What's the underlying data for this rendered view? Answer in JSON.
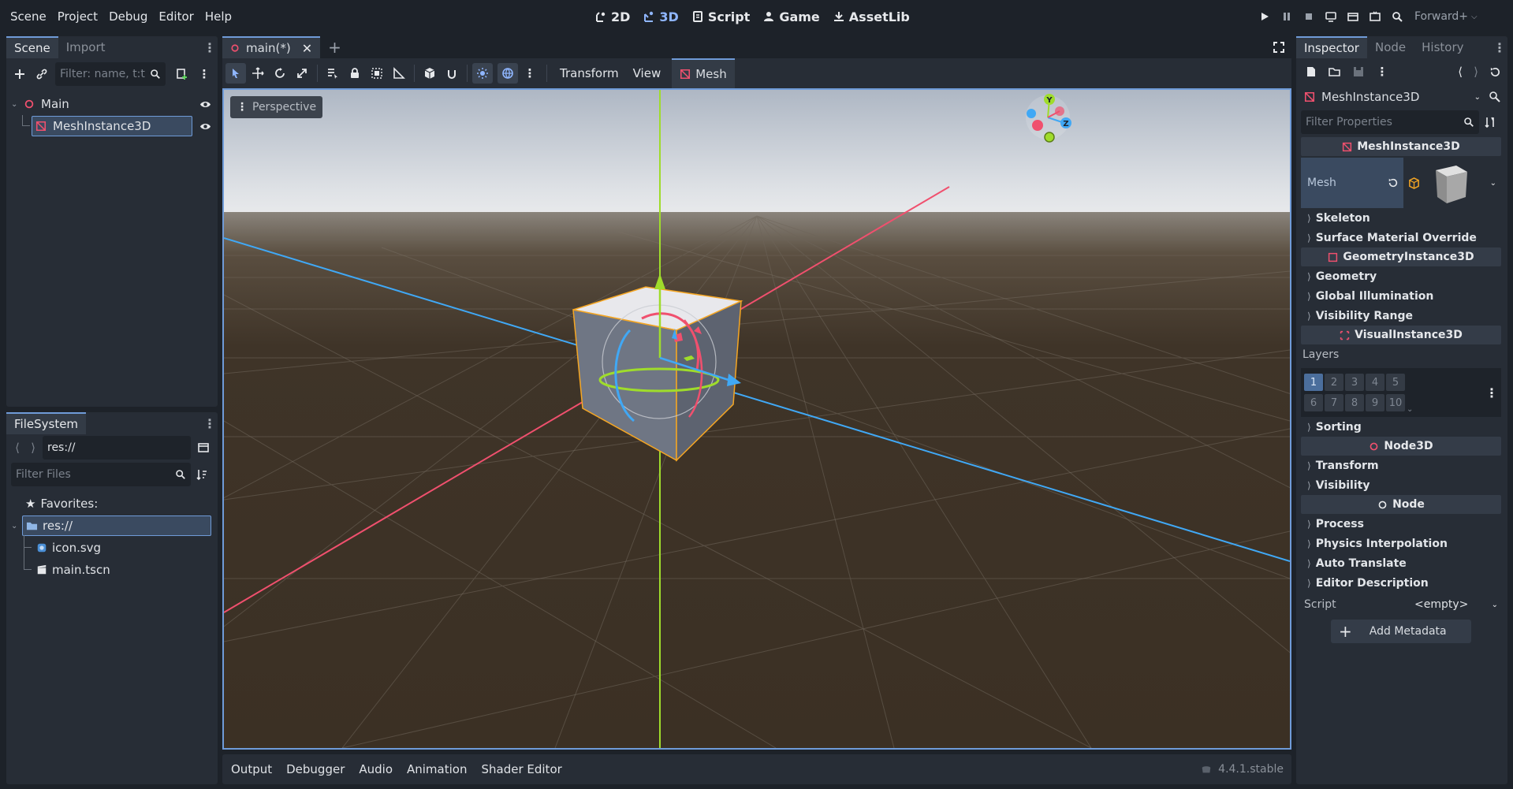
{
  "menu": [
    "Scene",
    "Project",
    "Debug",
    "Editor",
    "Help"
  ],
  "workspaces": [
    {
      "label": "2D",
      "icon": "2d-icon",
      "active": false
    },
    {
      "label": "3D",
      "icon": "3d-icon",
      "active": true
    },
    {
      "label": "Script",
      "icon": "script-icon",
      "active": false
    },
    {
      "label": "Game",
      "icon": "game-icon",
      "active": false
    },
    {
      "label": "AssetLib",
      "icon": "assetlib-icon",
      "active": false
    }
  ],
  "run_controls": [
    "play-icon",
    "pause-icon",
    "stop-icon",
    "remote-debug-icon",
    "movie-maker-icon",
    "play-scene-icon",
    "play-custom-icon"
  ],
  "renderer": "Forward+",
  "scene_dock": {
    "tabs": [
      "Scene",
      "Import"
    ],
    "filter_placeholder": "Filter: name, t:t",
    "tree": [
      {
        "label": "Main",
        "icon": "node3d-icon",
        "depth": 0
      },
      {
        "label": "MeshInstance3D",
        "icon": "meshinstance-icon",
        "depth": 1,
        "selected": true
      }
    ]
  },
  "filesystem_dock": {
    "tab": "FileSystem",
    "path": "res://",
    "filter_placeholder": "Filter Files",
    "favorites_label": "Favorites:",
    "tree": [
      {
        "label": "res://",
        "icon": "folder-icon",
        "selected": true
      },
      {
        "label": "icon.svg",
        "icon": "svg-file-icon"
      },
      {
        "label": "main.tscn",
        "icon": "scene-file-icon"
      }
    ]
  },
  "viewport": {
    "scene_tab": "main(*)",
    "toolbar_menus": [
      "Transform",
      "View"
    ],
    "mesh_menu": "Mesh",
    "perspective_label": "Perspective",
    "gizmo_axes": [
      "Y",
      "Z"
    ]
  },
  "bottom_panel": {
    "items": [
      "Output",
      "Debugger",
      "Audio",
      "Animation",
      "Shader Editor"
    ],
    "version": "4.4.1.stable"
  },
  "inspector": {
    "tabs": [
      "Inspector",
      "Node",
      "History"
    ],
    "node_selector": "MeshInstance3D",
    "filter_placeholder": "Filter Properties",
    "mesh_section": "MeshInstance3D",
    "mesh_label": "Mesh",
    "sections_mesh": [
      "Skeleton",
      "Surface Material Override"
    ],
    "geometry_section": "GeometryInstance3D",
    "sections_geometry": [
      "Geometry",
      "Global Illumination",
      "Visibility Range"
    ],
    "visual_section": "VisualInstance3D",
    "layers_label": "Layers",
    "layers_row1": [
      "1",
      "2",
      "3",
      "4",
      "5"
    ],
    "layers_row2": [
      "6",
      "7",
      "8",
      "9",
      "10"
    ],
    "sorting_label": "Sorting",
    "node3d_section": "Node3D",
    "sections_node3d": [
      "Transform",
      "Visibility"
    ],
    "node_section": "Node",
    "sections_node": [
      "Process",
      "Physics Interpolation",
      "Auto Translate",
      "Editor Description"
    ],
    "script_label": "Script",
    "script_value": "<empty>",
    "add_metadata": "Add Metadata"
  },
  "colors": {
    "accent": "#6f9bd8",
    "x_axis": "#f0506e",
    "y_axis": "#9fdc2b",
    "z_axis": "#40a8f5",
    "selection": "#f5a623"
  }
}
